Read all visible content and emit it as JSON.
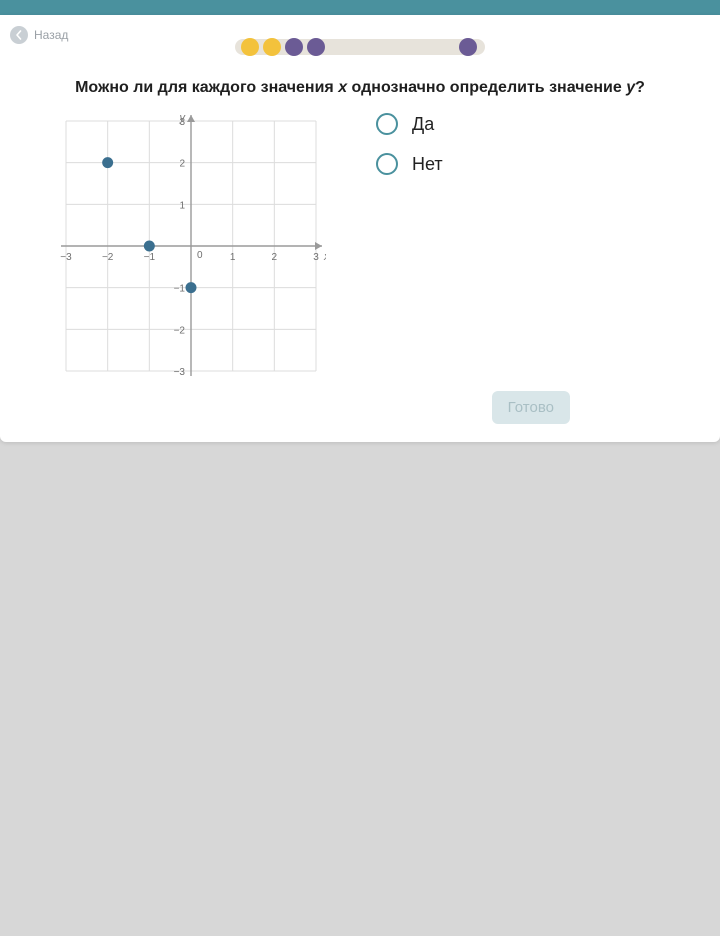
{
  "nav": {
    "back_label": "Назад"
  },
  "progress": {
    "dots": [
      {
        "color": "yellow",
        "x": 6
      },
      {
        "color": "yellow",
        "x": 28
      },
      {
        "color": "purple",
        "x": 50
      },
      {
        "color": "purple",
        "x": 72
      },
      {
        "color": "purple",
        "x": 224
      }
    ]
  },
  "question": {
    "pre": "Можно ли для каждого значения ",
    "var1": "x",
    "mid": " однозначно определить значение ",
    "var2": "y",
    "post": "?"
  },
  "answers": {
    "yes": "Да",
    "no": "Нет"
  },
  "submit_label": "Готово",
  "chart_data": {
    "type": "scatter",
    "xlabel": "x",
    "ylabel": "y",
    "xlim": [
      -3,
      3
    ],
    "ylim": [
      -3,
      3
    ],
    "xticks": [
      -3,
      -2,
      -1,
      0,
      1,
      2,
      3
    ],
    "yticks": [
      -3,
      -2,
      -1,
      1,
      2,
      3
    ],
    "points": [
      {
        "x": -2,
        "y": 2
      },
      {
        "x": -1,
        "y": 0
      },
      {
        "x": 0,
        "y": -1
      }
    ],
    "point_color": "#3b6f8f"
  }
}
